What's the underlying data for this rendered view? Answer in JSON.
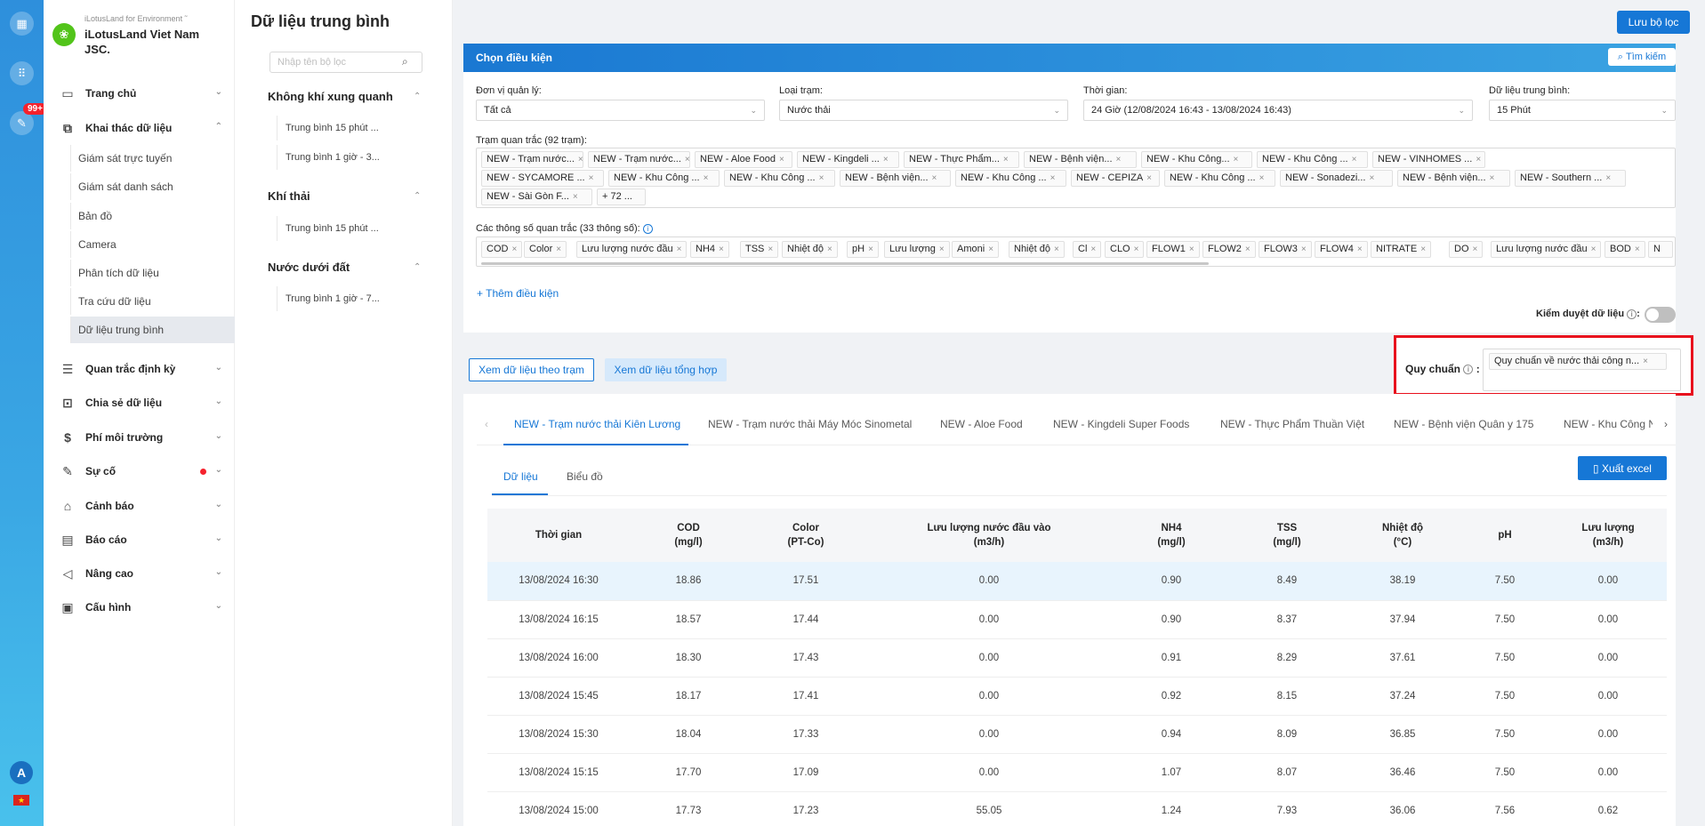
{
  "rail": {
    "badge": "99+",
    "avatar": "A",
    "flag": "★"
  },
  "brand": {
    "sub": "iLotusLand for Environment ˜",
    "name": "iLotusLand Viet Nam JSC."
  },
  "nav": [
    {
      "label": "Trang chủ",
      "icon": "home-icon"
    },
    {
      "label": "Khai thác dữ liệu",
      "icon": "data-mining-icon"
    },
    {
      "label": "Quan trắc định kỳ",
      "icon": "periodic-icon"
    },
    {
      "label": "Chia sẻ dữ liệu",
      "icon": "share-icon"
    },
    {
      "label": "Phí môi trường",
      "icon": "fee-icon"
    },
    {
      "label": "Sự cố",
      "icon": "incident-icon"
    },
    {
      "label": "Cảnh báo",
      "icon": "alert-bell-icon"
    },
    {
      "label": "Báo cáo",
      "icon": "report-icon"
    },
    {
      "label": "Nâng cao",
      "icon": "megaphone-icon"
    },
    {
      "label": "Cấu hình",
      "icon": "config-icon"
    }
  ],
  "subnav": [
    "Giám sát trực tuyến",
    "Giám sát danh sách",
    "Bản đồ",
    "Camera",
    "Phân tích dữ liệu",
    "Tra cứu dữ liệu",
    "Dữ liệu trung bình"
  ],
  "page_title": "Dữ liệu trung bình",
  "filter": {
    "search_placeholder": "Nhập tên bộ lọc",
    "groups": [
      {
        "title": "Không khí xung quanh",
        "items": [
          "Trung bình 15 phút ...",
          "Trung bình 1 giờ - 3..."
        ]
      },
      {
        "title": "Khí thải",
        "items": [
          "Trung bình 15 phút ..."
        ]
      },
      {
        "title": "Nước dưới đất",
        "items": [
          "Trung bình 1 giờ - 7..."
        ]
      }
    ]
  },
  "save_filter": "Lưu bộ lọc",
  "cond": {
    "header": "Chọn điều kiện",
    "search": "Tìm kiếm",
    "unit_label": "Đơn vị quản lý:",
    "unit_value": "Tất cả",
    "type_label": "Loại trạm:",
    "type_value": "Nước thải",
    "time_label": "Thời gian:",
    "time_value": "24 Giờ (12/08/2024 16:43 - 13/08/2024 16:43)",
    "avg_label": "Dữ liệu trung bình:",
    "avg_value": "15 Phút",
    "stations_label": "Trạm quan trắc (92 trạm):",
    "stations_row1": [
      "NEW - Trạm nước...",
      "NEW - Trạm nước...",
      "NEW - Aloe Food",
      "NEW - Kingdeli ...",
      "NEW - Thực Phẩm...",
      "NEW - Bệnh viện...",
      "NEW -  Khu Công...",
      "NEW - Khu Công ...",
      "NEW - VINHOMES ..."
    ],
    "stations_row2": [
      "NEW - SYCAMORE ...",
      "NEW - Khu Công ...",
      "NEW - Khu Công ...",
      "NEW - Bệnh viện...",
      "NEW - Khu Công ...",
      "NEW - CEPIZA",
      "NEW - Khu Công ...",
      "NEW -  Sonadezi...",
      "NEW - Bệnh viện...",
      "NEW - Southern ..."
    ],
    "stations_row3": [
      "NEW - Sài Gòn F..."
    ],
    "stations_more": "+ 72 ...",
    "params_label": "Các thông số quan trắc (33 thông số)",
    "params": [
      "COD",
      "Color",
      "Lưu lượng nước đầu",
      "NH4",
      "TSS",
      "Nhiệt độ",
      "pH",
      "Lưu lượng",
      "Amoni",
      "Nhiệt độ",
      "Cl",
      "CLO",
      "FLOW1",
      "FLOW2",
      "FLOW3",
      "FLOW4",
      "NITRATE",
      "DO",
      "Lưu lượng nước đầu",
      "BOD",
      "N"
    ],
    "add": "+ Thêm điều kiện",
    "review": "Kiểm duyệt dữ liệu"
  },
  "view_by_station": "Xem dữ liệu theo trạm",
  "view_summary": "Xem dữ liệu tổng hợp",
  "standard": {
    "label": "Quy chuẩn",
    "tag": "Quy chuẩn về nước thải công n..."
  },
  "station_tabs": [
    "NEW - Trạm nước thải Kiên Lương",
    "NEW - Trạm nước thải Máy Móc Sinometal",
    "NEW - Aloe Food",
    "NEW - Kingdeli Super Foods",
    "NEW - Thực Phẩm Thuần Việt",
    "NEW - Bệnh viện Quân y 175",
    "NEW -  Khu Công N"
  ],
  "sub_tabs": [
    "Dữ liệu",
    "Biểu đồ"
  ],
  "excel": "Xuất excel",
  "table": {
    "headers": [
      {
        "l1": "Thời gian",
        "l2": ""
      },
      {
        "l1": "COD",
        "l2": "(mg/l)"
      },
      {
        "l1": "Color",
        "l2": "(PT-Co)"
      },
      {
        "l1": "Lưu lượng nước đầu vào",
        "l2": "(m3/h)"
      },
      {
        "l1": "NH4",
        "l2": "(mg/l)"
      },
      {
        "l1": "TSS",
        "l2": "(mg/l)"
      },
      {
        "l1": "Nhiệt độ",
        "l2": "(°C)"
      },
      {
        "l1": "pH",
        "l2": ""
      },
      {
        "l1": "Lưu lượng",
        "l2": "(m3/h)"
      }
    ],
    "rows": [
      [
        "13/08/2024 16:30",
        "18.86",
        "17.51",
        "0.00",
        "0.90",
        "8.49",
        "38.19",
        "7.50",
        "0.00"
      ],
      [
        "13/08/2024 16:15",
        "18.57",
        "17.44",
        "0.00",
        "0.90",
        "8.37",
        "37.94",
        "7.50",
        "0.00"
      ],
      [
        "13/08/2024 16:00",
        "18.30",
        "17.43",
        "0.00",
        "0.91",
        "8.29",
        "37.61",
        "7.50",
        "0.00"
      ],
      [
        "13/08/2024 15:45",
        "18.17",
        "17.41",
        "0.00",
        "0.92",
        "8.15",
        "37.24",
        "7.50",
        "0.00"
      ],
      [
        "13/08/2024 15:30",
        "18.04",
        "17.33",
        "0.00",
        "0.94",
        "8.09",
        "36.85",
        "7.50",
        "0.00"
      ],
      [
        "13/08/2024 15:15",
        "17.70",
        "17.09",
        "0.00",
        "1.07",
        "8.07",
        "36.46",
        "7.50",
        "0.00"
      ],
      [
        "13/08/2024 15:00",
        "17.73",
        "17.23",
        "55.05",
        "1.24",
        "7.93",
        "36.06",
        "7.56",
        "0.62"
      ]
    ]
  }
}
